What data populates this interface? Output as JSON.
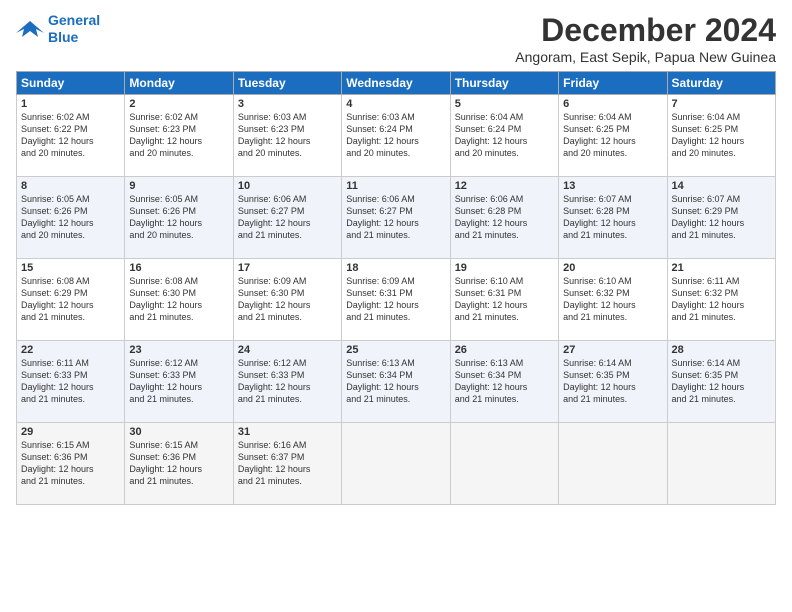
{
  "logo": {
    "line1": "General",
    "line2": "Blue"
  },
  "title": "December 2024",
  "subtitle": "Angoram, East Sepik, Papua New Guinea",
  "days_header": [
    "Sunday",
    "Monday",
    "Tuesday",
    "Wednesday",
    "Thursday",
    "Friday",
    "Saturday"
  ],
  "weeks": [
    [
      {
        "day": "1",
        "info": "Sunrise: 6:02 AM\nSunset: 6:22 PM\nDaylight: 12 hours\nand 20 minutes."
      },
      {
        "day": "2",
        "info": "Sunrise: 6:02 AM\nSunset: 6:23 PM\nDaylight: 12 hours\nand 20 minutes."
      },
      {
        "day": "3",
        "info": "Sunrise: 6:03 AM\nSunset: 6:23 PM\nDaylight: 12 hours\nand 20 minutes."
      },
      {
        "day": "4",
        "info": "Sunrise: 6:03 AM\nSunset: 6:24 PM\nDaylight: 12 hours\nand 20 minutes."
      },
      {
        "day": "5",
        "info": "Sunrise: 6:04 AM\nSunset: 6:24 PM\nDaylight: 12 hours\nand 20 minutes."
      },
      {
        "day": "6",
        "info": "Sunrise: 6:04 AM\nSunset: 6:25 PM\nDaylight: 12 hours\nand 20 minutes."
      },
      {
        "day": "7",
        "info": "Sunrise: 6:04 AM\nSunset: 6:25 PM\nDaylight: 12 hours\nand 20 minutes."
      }
    ],
    [
      {
        "day": "8",
        "info": "Sunrise: 6:05 AM\nSunset: 6:26 PM\nDaylight: 12 hours\nand 20 minutes."
      },
      {
        "day": "9",
        "info": "Sunrise: 6:05 AM\nSunset: 6:26 PM\nDaylight: 12 hours\nand 20 minutes."
      },
      {
        "day": "10",
        "info": "Sunrise: 6:06 AM\nSunset: 6:27 PM\nDaylight: 12 hours\nand 21 minutes."
      },
      {
        "day": "11",
        "info": "Sunrise: 6:06 AM\nSunset: 6:27 PM\nDaylight: 12 hours\nand 21 minutes."
      },
      {
        "day": "12",
        "info": "Sunrise: 6:06 AM\nSunset: 6:28 PM\nDaylight: 12 hours\nand 21 minutes."
      },
      {
        "day": "13",
        "info": "Sunrise: 6:07 AM\nSunset: 6:28 PM\nDaylight: 12 hours\nand 21 minutes."
      },
      {
        "day": "14",
        "info": "Sunrise: 6:07 AM\nSunset: 6:29 PM\nDaylight: 12 hours\nand 21 minutes."
      }
    ],
    [
      {
        "day": "15",
        "info": "Sunrise: 6:08 AM\nSunset: 6:29 PM\nDaylight: 12 hours\nand 21 minutes."
      },
      {
        "day": "16",
        "info": "Sunrise: 6:08 AM\nSunset: 6:30 PM\nDaylight: 12 hours\nand 21 minutes."
      },
      {
        "day": "17",
        "info": "Sunrise: 6:09 AM\nSunset: 6:30 PM\nDaylight: 12 hours\nand 21 minutes."
      },
      {
        "day": "18",
        "info": "Sunrise: 6:09 AM\nSunset: 6:31 PM\nDaylight: 12 hours\nand 21 minutes."
      },
      {
        "day": "19",
        "info": "Sunrise: 6:10 AM\nSunset: 6:31 PM\nDaylight: 12 hours\nand 21 minutes."
      },
      {
        "day": "20",
        "info": "Sunrise: 6:10 AM\nSunset: 6:32 PM\nDaylight: 12 hours\nand 21 minutes."
      },
      {
        "day": "21",
        "info": "Sunrise: 6:11 AM\nSunset: 6:32 PM\nDaylight: 12 hours\nand 21 minutes."
      }
    ],
    [
      {
        "day": "22",
        "info": "Sunrise: 6:11 AM\nSunset: 6:33 PM\nDaylight: 12 hours\nand 21 minutes."
      },
      {
        "day": "23",
        "info": "Sunrise: 6:12 AM\nSunset: 6:33 PM\nDaylight: 12 hours\nand 21 minutes."
      },
      {
        "day": "24",
        "info": "Sunrise: 6:12 AM\nSunset: 6:33 PM\nDaylight: 12 hours\nand 21 minutes."
      },
      {
        "day": "25",
        "info": "Sunrise: 6:13 AM\nSunset: 6:34 PM\nDaylight: 12 hours\nand 21 minutes."
      },
      {
        "day": "26",
        "info": "Sunrise: 6:13 AM\nSunset: 6:34 PM\nDaylight: 12 hours\nand 21 minutes."
      },
      {
        "day": "27",
        "info": "Sunrise: 6:14 AM\nSunset: 6:35 PM\nDaylight: 12 hours\nand 21 minutes."
      },
      {
        "day": "28",
        "info": "Sunrise: 6:14 AM\nSunset: 6:35 PM\nDaylight: 12 hours\nand 21 minutes."
      }
    ],
    [
      {
        "day": "29",
        "info": "Sunrise: 6:15 AM\nSunset: 6:36 PM\nDaylight: 12 hours\nand 21 minutes."
      },
      {
        "day": "30",
        "info": "Sunrise: 6:15 AM\nSunset: 6:36 PM\nDaylight: 12 hours\nand 21 minutes."
      },
      {
        "day": "31",
        "info": "Sunrise: 6:16 AM\nSunset: 6:37 PM\nDaylight: 12 hours\nand 21 minutes."
      },
      {
        "day": "",
        "info": ""
      },
      {
        "day": "",
        "info": ""
      },
      {
        "day": "",
        "info": ""
      },
      {
        "day": "",
        "info": ""
      }
    ]
  ]
}
